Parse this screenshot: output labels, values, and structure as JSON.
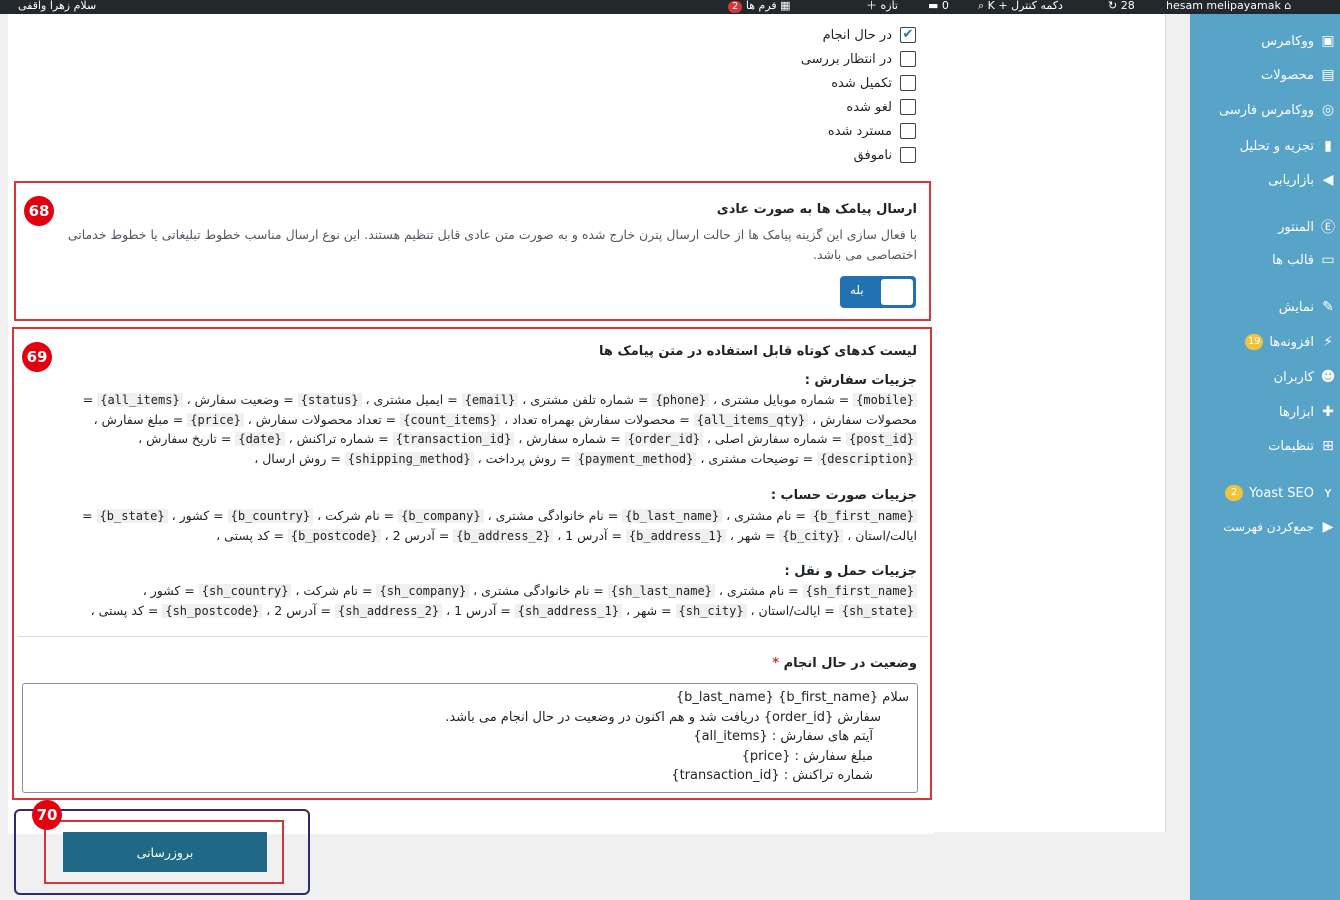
{
  "adminbar": {
    "site_name": "hesam melipayamak",
    "updates_count": "28",
    "shortcut": "دکمه کنترل + K",
    "comments_count": "0",
    "new_label": "تازه",
    "forms_count": "2",
    "forms_label": "فرم ها",
    "greeting": "سلام زهرا واقفی"
  },
  "sidebar": {
    "items": [
      {
        "label": "ووکامرس",
        "icon": "woo-icon"
      },
      {
        "label": "محصولات",
        "icon": "archive-icon"
      },
      {
        "label": "ووکامرس فارسی",
        "icon": "persian-woo-icon"
      },
      {
        "label": "تجزیه و تحلیل",
        "icon": "chart-bar-icon"
      },
      {
        "label": "بازاریابی",
        "icon": "megaphone-icon"
      },
      {
        "label": "المنتور",
        "icon": "elementor-icon"
      },
      {
        "label": "قالب ها",
        "icon": "template-icon"
      },
      {
        "label": "نمایش",
        "icon": "brush-icon"
      },
      {
        "label": "افزونه‌ها",
        "icon": "plug-icon",
        "count": "19"
      },
      {
        "label": "کاربران",
        "icon": "users-icon"
      },
      {
        "label": "ابزارها",
        "icon": "wrench-icon"
      },
      {
        "label": "تنظیمات",
        "icon": "settings-icon"
      },
      {
        "label": "Yoast SEO",
        "icon": "yoast-icon",
        "count": "2"
      },
      {
        "label": "جمع‌کردن فهرست",
        "icon": "collapse-icon"
      }
    ]
  },
  "statuses": [
    {
      "label": "در حال انجام",
      "checked": true
    },
    {
      "label": "در انتظار بررسی",
      "checked": false
    },
    {
      "label": "تکمیل شده",
      "checked": false
    },
    {
      "label": "لغو شده",
      "checked": false
    },
    {
      "label": "مسترد شده",
      "checked": false
    },
    {
      "label": "ناموفق",
      "checked": false
    }
  ],
  "normal_sms": {
    "badge": "68",
    "title": "ارسال پیامک ها به صورت عادی",
    "desc_line1": "با فعال سازی این گزینه پیامک ها از حالت ارسال پترن خارج شده و به صورت متن عادی قابل تنظیم هستند. این نوع ارسال مناسب خطوط تبلیغاتی یا خطوط خدماتی",
    "desc_line2": "اختصاصی می باشد.",
    "toggle_label": "بله"
  },
  "shortcodes": {
    "badge": "69",
    "title": "لیست کدهای کوتاه قابل استفاده در متن پیامک ها",
    "order": {
      "heading": "جزییات سفارش :",
      "lines": [
        [
          [
            "{mobile}",
            " = شماره موبایل مشتری ، "
          ],
          [
            "{phone}",
            " = شماره تلفن مشتری ، "
          ],
          [
            "{email}",
            " = ایمیل مشتری ، "
          ],
          [
            "{status}",
            " = وضعیت سفارش ، "
          ],
          [
            "{all_items}",
            " ="
          ]
        ],
        [
          [
            "",
            "محصولات سفارش ، "
          ],
          [
            "{all_items_qty}",
            " = محصولات سفارش بهمراه تعداد ، "
          ],
          [
            "{count_items}",
            " = تعداد محصولات سفارش ، "
          ],
          [
            "{price}",
            " = مبلغ سفارش ،"
          ]
        ],
        [
          [
            "{post_id}",
            " = شماره سفارش اصلی ، "
          ],
          [
            "{order_id}",
            " = شماره سفارش ، "
          ],
          [
            "{transaction_id}",
            " = شماره تراکنش ، "
          ],
          [
            "{date}",
            " = تاریخ سفارش ،"
          ]
        ],
        [
          [
            "{description}",
            " = توضیحات مشتری ، "
          ],
          [
            "{payment_method}",
            " = روش پرداخت ، "
          ],
          [
            "{shipping_method}",
            " = روش ارسال ،"
          ]
        ]
      ]
    },
    "billing": {
      "heading": "جزییات صورت حساب :",
      "lines": [
        [
          [
            "{b_first_name}",
            " = نام مشتری ، "
          ],
          [
            "{b_last_name}",
            " = نام خانوادگی مشتری ، "
          ],
          [
            "{b_company}",
            " = نام شرکت ، "
          ],
          [
            "{b_country}",
            " = کشور ، "
          ],
          [
            "{b_state}",
            " ="
          ]
        ],
        [
          [
            "",
            "ایالت/استان ، "
          ],
          [
            "{b_city}",
            " = شهر ، "
          ],
          [
            "{b_address_1}",
            " = آدرس 1 ، "
          ],
          [
            "{b_address_2}",
            " = آدرس 2 ، "
          ],
          [
            "{b_postcode}",
            " = کد پستی ،"
          ]
        ]
      ]
    },
    "shipping": {
      "heading": "جزییات حمل و نقل :",
      "lines": [
        [
          [
            "{sh_first_name}",
            " = نام مشتری ، "
          ],
          [
            "{sh_last_name}",
            " = نام خانوادگی مشتری ، "
          ],
          [
            "{sh_company}",
            " = نام شرکت ، "
          ],
          [
            "{sh_country}",
            " = کشور ،"
          ]
        ],
        [
          [
            "{sh_state}",
            " = ایالت/استان ، "
          ],
          [
            "{sh_city}",
            " = شهر ، "
          ],
          [
            "{sh_address_1}",
            " = آدرس 1 ، "
          ],
          [
            "{sh_address_2}",
            " = آدرس 2 ، "
          ],
          [
            "{sh_postcode}",
            " = کد پستی ،"
          ]
        ]
      ]
    },
    "template_label": "وضعیت در حال انجام",
    "required_mark": "*",
    "template_lines": [
      "سلام {b_first_name} {b_last_name}",
      "سفارش {order_id} دریافت شد و هم اکنون در وضعیت در حال انجام می باشد.",
      "آیتم های سفارش : {all_items}",
      "مبلغ سفارش : {price}",
      "شماره تراکنش : {transaction_id}"
    ]
  },
  "update": {
    "badge": "70",
    "button_label": "بروزرسانی"
  },
  "colors": {
    "sidebar": "#58a4c9",
    "highlight_red": "#d63638",
    "button": "#206986",
    "toggle": "#2271b1"
  }
}
